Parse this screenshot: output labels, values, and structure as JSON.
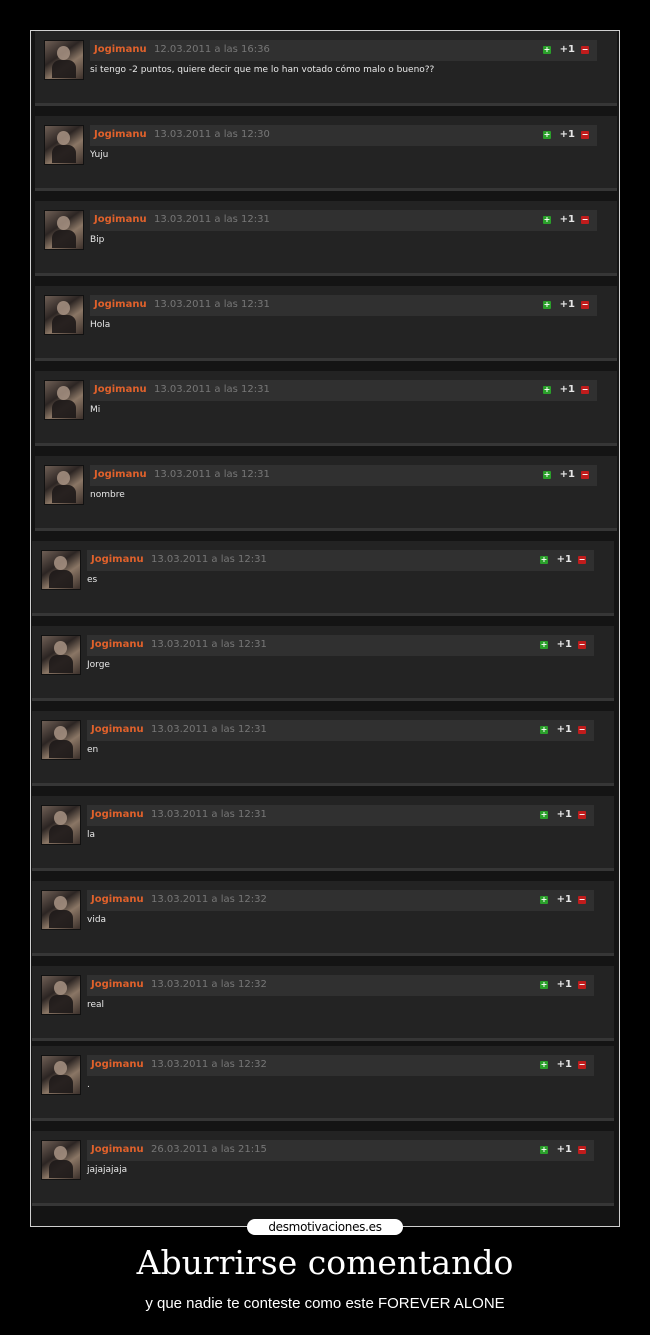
{
  "comments": [
    {
      "author": "Jogimanu",
      "date": "12.03.2011 a las 16:36",
      "text": "si tengo -2 puntos, quiere decir que me lo han votado cómo malo o bueno??",
      "score": "+1"
    },
    {
      "author": "Jogimanu",
      "date": "13.03.2011 a las 12:30",
      "text": "Yuju",
      "score": "+1"
    },
    {
      "author": "Jogimanu",
      "date": "13.03.2011 a las 12:31",
      "text": "Bip",
      "score": "+1"
    },
    {
      "author": "Jogimanu",
      "date": "13.03.2011 a las 12:31",
      "text": "Hola",
      "score": "+1"
    },
    {
      "author": "Jogimanu",
      "date": "13.03.2011 a las 12:31",
      "text": "Mi",
      "score": "+1"
    },
    {
      "author": "Jogimanu",
      "date": "13.03.2011 a las 12:31",
      "text": "nombre",
      "score": "+1"
    },
    {
      "author": "Jogimanu",
      "date": "13.03.2011 a las 12:31",
      "text": "es",
      "score": "+1"
    },
    {
      "author": "Jogimanu",
      "date": "13.03.2011 a las 12:31",
      "text": "Jorge",
      "score": "+1"
    },
    {
      "author": "Jogimanu",
      "date": "13.03.2011 a las 12:31",
      "text": "en",
      "score": "+1"
    },
    {
      "author": "Jogimanu",
      "date": "13.03.2011 a las 12:31",
      "text": "la",
      "score": "+1"
    },
    {
      "author": "Jogimanu",
      "date": "13.03.2011 a las 12:32",
      "text": "vida",
      "score": "+1"
    },
    {
      "author": "Jogimanu",
      "date": "13.03.2011 a las 12:32",
      "text": "real",
      "score": "+1"
    },
    {
      "author": "Jogimanu",
      "date": "13.03.2011 a las 12:32",
      "text": ".",
      "score": "+1"
    },
    {
      "author": "Jogimanu",
      "date": "26.03.2011 a las 21:15",
      "text": "jajajajaja",
      "score": "+1"
    }
  ],
  "vote_up_icon": "plus-icon",
  "vote_down_icon": "minus-icon",
  "watermark": "desmotivaciones.es",
  "poster": {
    "title": "Aburrirse comentando",
    "subtitle": "y que nadie te conteste como este FOREVER ALONE"
  },
  "colors": {
    "author": "#e0612b",
    "vote_up": "#2aa02a",
    "vote_down": "#c01c1c"
  }
}
